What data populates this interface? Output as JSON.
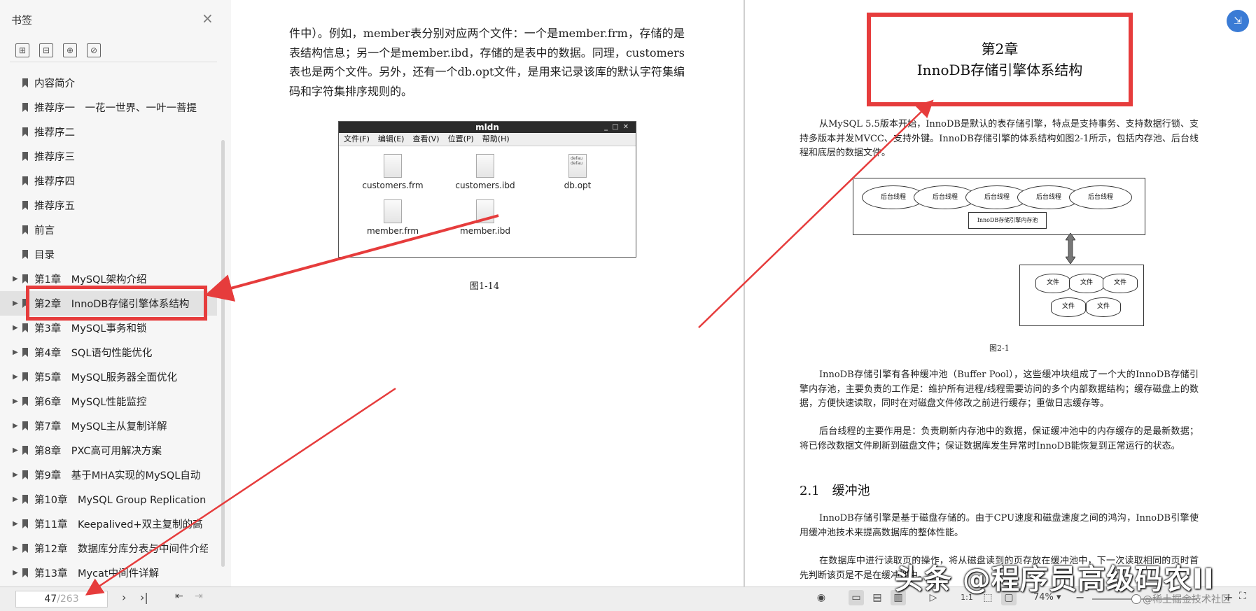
{
  "sidebar": {
    "title": "书签",
    "close_icon": "×",
    "tools": [
      "⊞",
      "⊟",
      "⊕",
      "⊘"
    ],
    "items": [
      {
        "label": "内容简介",
        "has_children": false
      },
      {
        "label": "推荐序一　一花一世界、一叶一菩提",
        "has_children": false
      },
      {
        "label": "推荐序二",
        "has_children": false
      },
      {
        "label": "推荐序三",
        "has_children": false
      },
      {
        "label": "推荐序四",
        "has_children": false
      },
      {
        "label": "推荐序五",
        "has_children": false
      },
      {
        "label": "前言",
        "has_children": false
      },
      {
        "label": "目录",
        "has_children": false
      },
      {
        "label": "第1章　MySQL架构介绍",
        "has_children": true
      },
      {
        "label": "第2章　InnoDB存储引擎体系结构",
        "has_children": true,
        "selected": true
      },
      {
        "label": "第3章　MySQL事务和锁",
        "has_children": true
      },
      {
        "label": "第4章　SQL语句性能优化",
        "has_children": true
      },
      {
        "label": "第5章　MySQL服务器全面优化",
        "has_children": true
      },
      {
        "label": "第6章　MySQL性能监控",
        "has_children": true
      },
      {
        "label": "第7章　MySQL主从复制详解",
        "has_children": true
      },
      {
        "label": "第8章　PXC高可用解决方案",
        "has_children": true
      },
      {
        "label": "第9章　基于MHA实现的MySQL自动",
        "has_children": true
      },
      {
        "label": "第10章　MySQL Group Replication",
        "has_children": true
      },
      {
        "label": "第11章　Keepalived+双主复制的高",
        "has_children": true
      },
      {
        "label": "第12章　数据库分库分表与中间件介绍",
        "has_children": true
      },
      {
        "label": "第13章　Mycat中间件详解",
        "has_children": true
      }
    ]
  },
  "left_page": {
    "paragraph": "件中）。例如，member表分别对应两个文件：一个是member.frm，存储的是表结构信息；另一个是member.ibd，存储的是表中的数据。同理，customers表也是两个文件。另外，还有一个db.opt文件，是用来记录该库的默认字符集编码和字符集排序规则的。",
    "window": {
      "title": "mldn",
      "menu": [
        "文件(F)",
        "编辑(E)",
        "查看(V)",
        "位置(P)",
        "帮助(H)"
      ],
      "files": [
        "customers.frm",
        "customers.ibd",
        "db.opt",
        "member.frm",
        "member.ibd"
      ],
      "db_opt_text": "defau defau"
    },
    "figure_caption": "图1-14"
  },
  "right_page": {
    "chapter_number": "第2章",
    "chapter_title": "InnoDB存储引擎体系结构",
    "intro": "从MySQL 5.5版本开始，InnoDB是默认的表存储引擎，特点是支持事务、支持数据行锁、支持多版本并发MVCC、支持外键。InnoDB存储引擎的体系结构如图2-1所示，包括内存池、后台线程和底层的数据文件。",
    "diagram": {
      "threads": [
        "后台线程",
        "后台线程",
        "后台线程",
        "后台线程",
        "后台线程"
      ],
      "memory_pool": "InnoDB存储引擎内存池",
      "files": [
        "文件",
        "文件",
        "文件",
        "文件",
        "文件"
      ]
    },
    "figure_caption": "图2-1",
    "para1": "InnoDB存储引擎有各种缓冲池（Buffer Pool），这些缓冲块组成了一个大的InnoDB存储引擎内存池，主要负责的工作是：维护所有进程/线程需要访问的多个内部数据结构；缓存磁盘上的数据，方便快速读取，同时在对磁盘文件修改之前进行缓存；重做日志缓存等。",
    "para2": "后台线程的主要作用是：负责刷新内存池中的数据，保证缓冲池中的内存缓存的是最新数据；将已修改数据文件刷新到磁盘文件；保证数据库发生异常时InnoDB能恢复到正常运行的状态。",
    "section_heading": "2.1　缓冲池",
    "para3": "InnoDB存储引擎是基于磁盘存储的。由于CPU速度和磁盘速度之间的鸿沟，InnoDB引擎使用缓冲池技术来提高数据库的整体性能。",
    "para4": "在数据库中进行读取页的操作，将从磁盘读到的页存放在缓冲池中，下一次读取相同的页时首先判断该页是不是在缓冲池中。"
  },
  "toolbar": {
    "current_page": "47",
    "total_pages": "/263",
    "zoom": "74%",
    "zoom_caret": "▾"
  },
  "watermark": {
    "main": "头条 @程序员高级码农II",
    "small": "@稀土掘金技术社区"
  },
  "colors": {
    "highlight": "#e63c3c",
    "float_button": "#3a7bd5"
  }
}
